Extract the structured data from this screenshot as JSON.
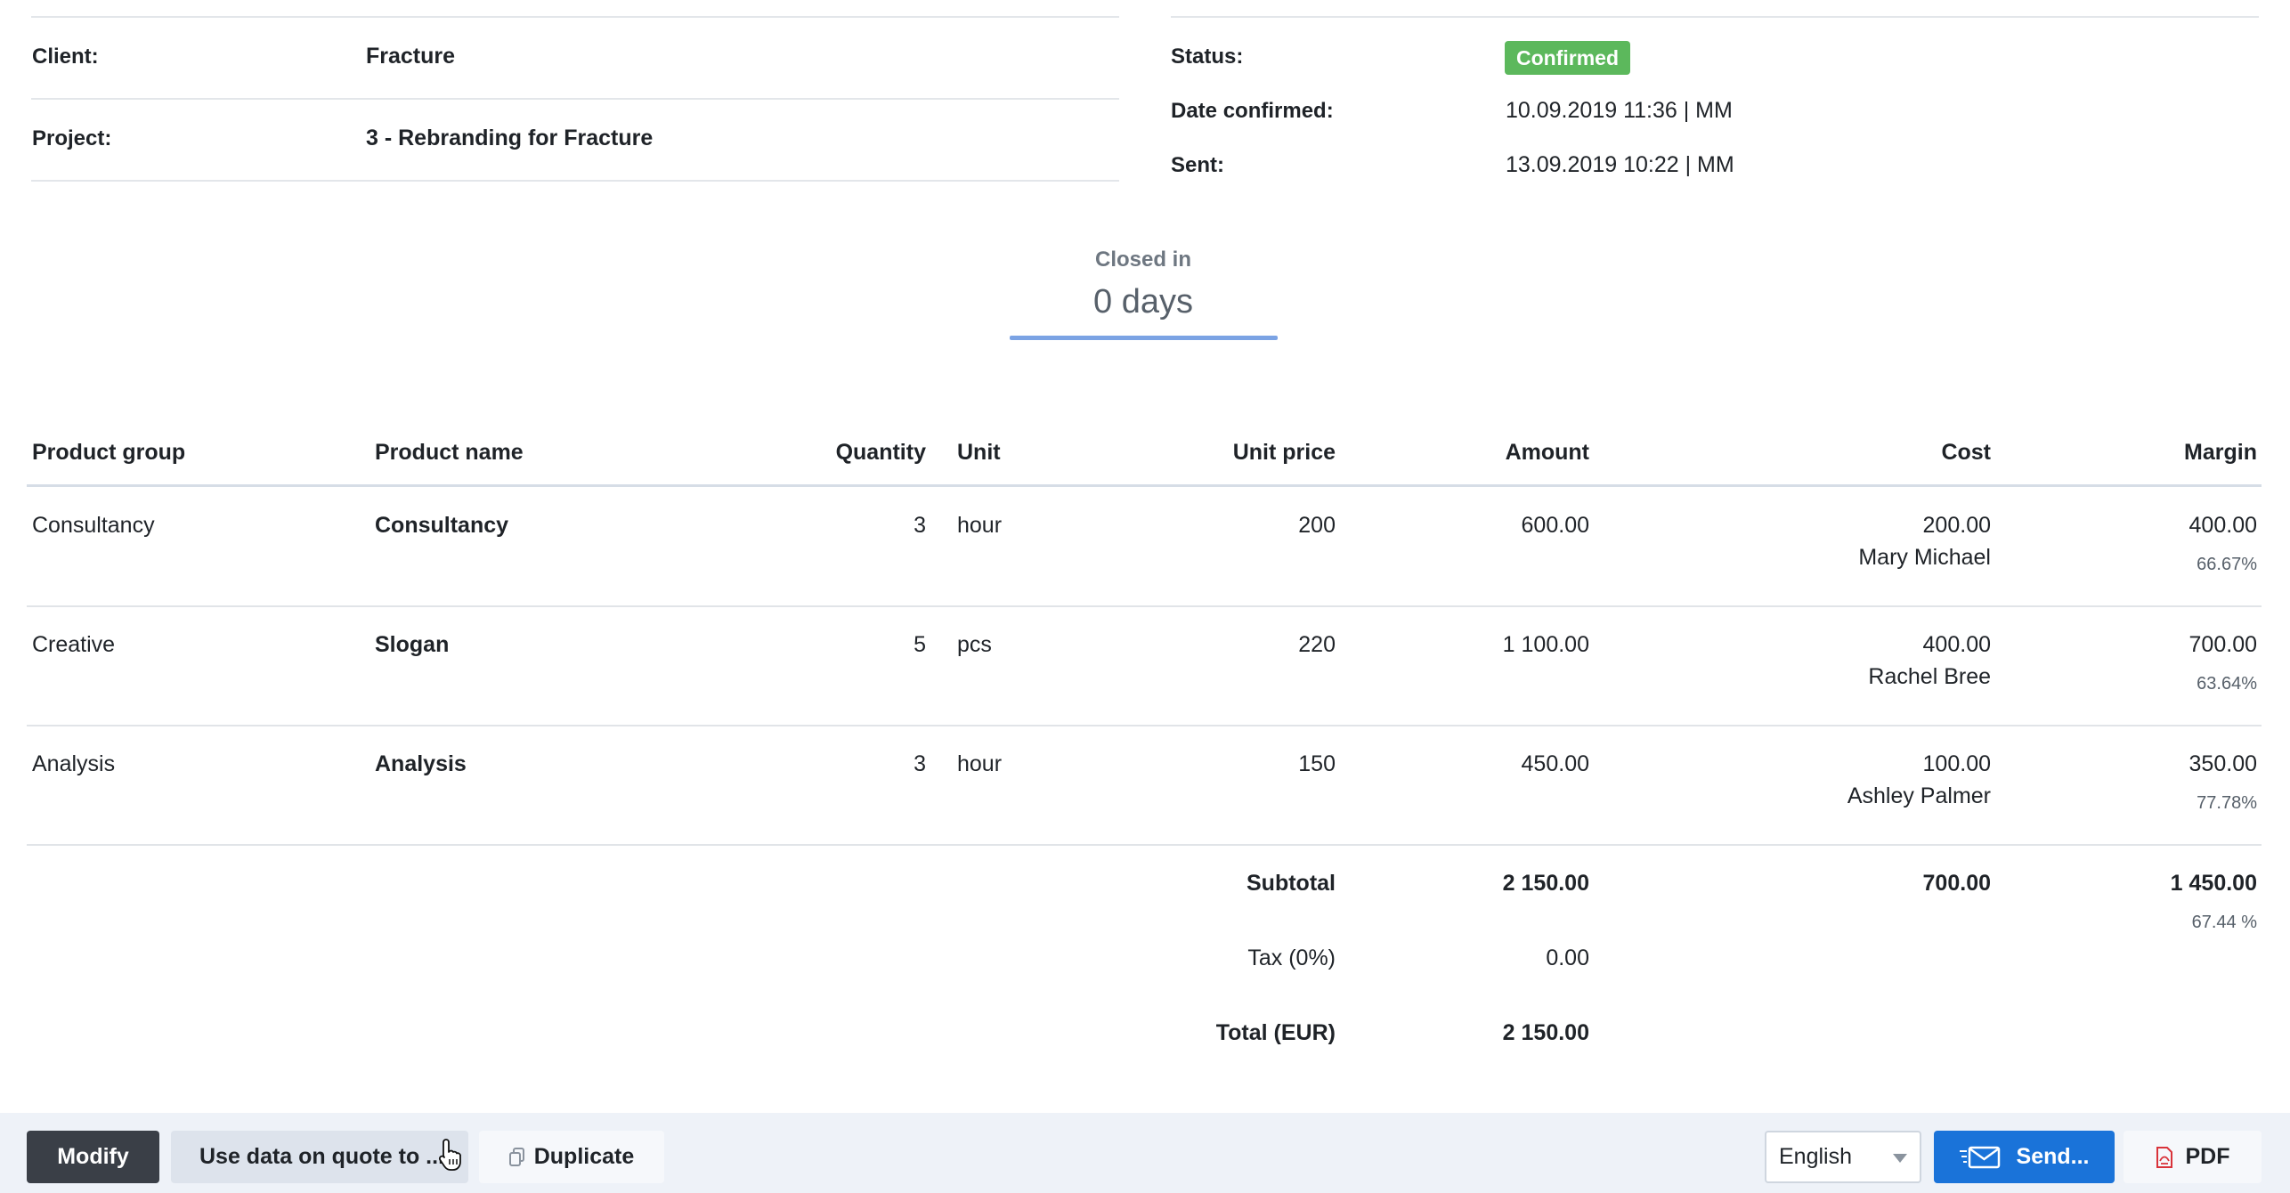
{
  "info": {
    "client_label": "Client:",
    "client_value": "Fracture",
    "project_label": "Project:",
    "project_value": "3 - Rebranding for Fracture",
    "status_label": "Status:",
    "status_value": "Confirmed",
    "date_confirmed_label": "Date confirmed:",
    "date_confirmed_value": "10.09.2019 11:36 | MM",
    "sent_label": "Sent:",
    "sent_value": "13.09.2019 10:22 | MM",
    "status_color": "#5cb85c"
  },
  "closed": {
    "label": "Closed in",
    "value": "0 days"
  },
  "table": {
    "headers": {
      "product_group": "Product group",
      "product_name": "Product name",
      "quantity": "Quantity",
      "unit": "Unit",
      "unit_price": "Unit price",
      "amount": "Amount",
      "cost": "Cost",
      "margin": "Margin"
    },
    "rows": [
      {
        "group": "Consultancy",
        "name": "Consultancy",
        "quantity": "3",
        "unit": "hour",
        "unit_price": "200",
        "amount": "600.00",
        "cost": "200.00",
        "cost_person": "Mary Michael",
        "margin": "400.00",
        "margin_pct": "66.67%"
      },
      {
        "group": "Creative",
        "name": "Slogan",
        "quantity": "5",
        "unit": "pcs",
        "unit_price": "220",
        "amount": "1 100.00",
        "cost": "400.00",
        "cost_person": "Rachel Bree",
        "margin": "700.00",
        "margin_pct": "63.64%"
      },
      {
        "group": "Analysis",
        "name": "Analysis",
        "quantity": "3",
        "unit": "hour",
        "unit_price": "150",
        "amount": "450.00",
        "cost": "100.00",
        "cost_person": "Ashley Palmer",
        "margin": "350.00",
        "margin_pct": "77.78%"
      }
    ],
    "subtotal_label": "Subtotal",
    "subtotal_amount": "2 150.00",
    "subtotal_cost": "700.00",
    "subtotal_margin": "1 450.00",
    "subtotal_margin_pct": "67.44 %",
    "tax_label": "Tax (0%)",
    "tax_amount": "0.00",
    "total_label": "Total (EUR)",
    "total_amount": "2 150.00"
  },
  "toolbar": {
    "modify_label": "Modify",
    "use_data_label": "Use data on quote to ...",
    "duplicate_label": "Duplicate",
    "language_value": "English",
    "send_label": "Send...",
    "pdf_label": "PDF",
    "send_color": "#1a73d9"
  }
}
